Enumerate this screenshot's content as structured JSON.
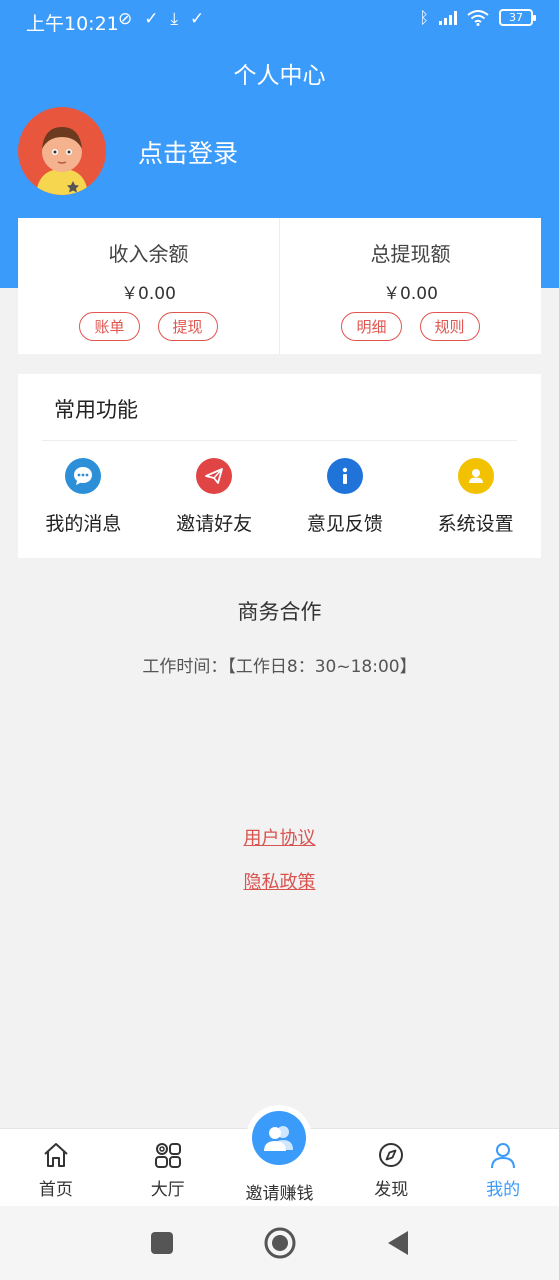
{
  "status": {
    "time": "上午10:21",
    "battery": "37"
  },
  "header": {
    "title": "个人中心",
    "login": "点击登录"
  },
  "balance": {
    "income": {
      "label": "收入余额",
      "value": "￥0.00",
      "buttons": [
        "账单",
        "提现"
      ]
    },
    "withdraw": {
      "label": "总提现额",
      "value": "￥0.00",
      "buttons": [
        "明细",
        "规则"
      ]
    }
  },
  "functions": {
    "title": "常用功能",
    "items": [
      {
        "label": "我的消息",
        "icon": "message-icon",
        "color": "#2d8fd8"
      },
      {
        "label": "邀请好友",
        "icon": "paper-plane-icon",
        "color": "#e04444"
      },
      {
        "label": "意见反馈",
        "icon": "info-icon",
        "color": "#1f73d9"
      },
      {
        "label": "系统设置",
        "icon": "user-settings-icon",
        "color": "#f2c200"
      }
    ]
  },
  "business": {
    "title": "商务合作",
    "hours": "工作时间：【工作日8：30~18:00】"
  },
  "links": {
    "user_agreement": "用户协议",
    "privacy_policy": "隐私政策"
  },
  "tabs": [
    {
      "label": "首页",
      "icon": "home-icon"
    },
    {
      "label": "大厅",
      "icon": "grid-icon"
    },
    {
      "label": "邀请赚钱",
      "icon": "people-icon"
    },
    {
      "label": "发现",
      "icon": "compass-icon"
    },
    {
      "label": "我的",
      "icon": "person-icon",
      "active": true
    }
  ],
  "colors": {
    "primary": "#3b9bfb",
    "accent_red": "#e0564f"
  }
}
